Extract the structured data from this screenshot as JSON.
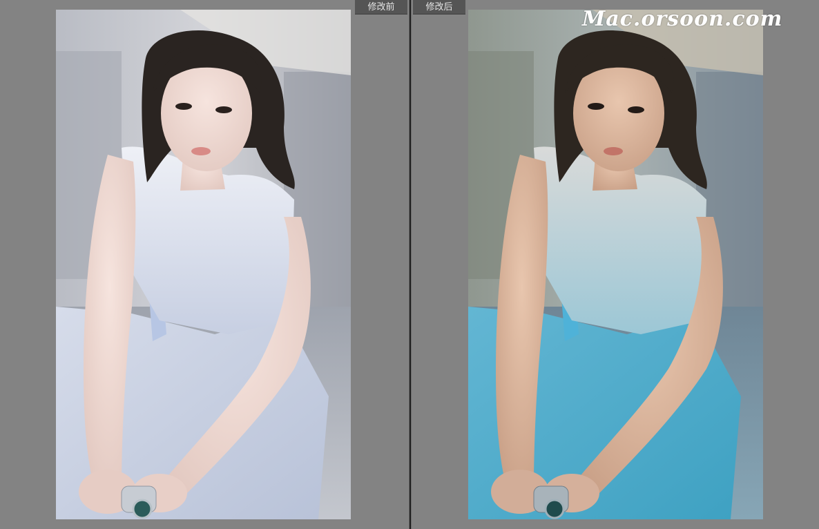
{
  "compare_view": {
    "before_label": "修改前",
    "after_label": "修改后"
  },
  "watermark": {
    "text": "Mac.orsoon.com"
  },
  "colors": {
    "workspace_background": "#848484",
    "label_background": "#555555",
    "label_text": "#e6e6e6",
    "divider": "#1f1f1f",
    "watermark": "#ffffff"
  },
  "icons": {
    "before_photo": "portrait-photo",
    "after_photo": "portrait-photo-edited"
  }
}
